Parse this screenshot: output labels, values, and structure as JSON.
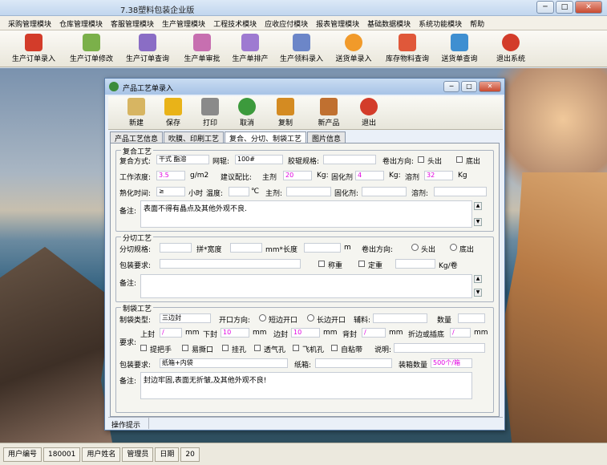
{
  "app": {
    "title": "7.38塑料包装企业版"
  },
  "window_buttons": {
    "min": "─",
    "max": "□",
    "close": "✕"
  },
  "menu": [
    "采购管理模块",
    "仓库管理模块",
    "客服管理模块",
    "生产管理模块",
    "工程技术模块",
    "应收应付模块",
    "报表管理模块",
    "基础数据模块",
    "系统功能模块",
    "帮助"
  ],
  "toolbar": [
    {
      "label": "生产订单录入",
      "icon": "pdf-icon",
      "color": "#d33c2a"
    },
    {
      "label": "生产订单修改",
      "icon": "flower-icon",
      "color": "#7bb04a"
    },
    {
      "label": "生产订单查询",
      "icon": "pen-doc-icon",
      "color": "#8a6dc5"
    },
    {
      "label": "生产单审批",
      "icon": "approve-icon",
      "color": "#c76fb0"
    },
    {
      "label": "生产单排产",
      "icon": "schedule-icon",
      "color": "#9e7ad1"
    },
    {
      "label": "生产领料录入",
      "icon": "material-icon",
      "color": "#6c86c8"
    },
    {
      "label": "送货单录入",
      "icon": "delivery-icon",
      "color": "#f19a2a"
    },
    {
      "label": "库存物料查询",
      "icon": "stock-icon",
      "color": "#e0583a"
    },
    {
      "label": "送货单查询",
      "icon": "feather-icon",
      "color": "#3f8fd1"
    },
    {
      "label": "退出系统",
      "icon": "power-icon",
      "color": "#d33c2a"
    }
  ],
  "status": [
    "用户编号",
    "180001",
    "用户姓名",
    "管理员",
    "日期",
    "20"
  ],
  "dialog": {
    "title": "产品工艺单录入",
    "toolbar": [
      {
        "label": "新建",
        "icon": "new-doc-icon",
        "color": "#d7b562"
      },
      {
        "label": "保存",
        "icon": "save-icon",
        "color": "#e9b318"
      },
      {
        "label": "打印",
        "icon": "print-icon",
        "color": "#8a8a8a"
      },
      {
        "label": "取消",
        "icon": "undo-icon",
        "color": "#3c9a3c"
      },
      {
        "label": "复制",
        "icon": "copy-icon",
        "color": "#d48b22"
      },
      {
        "label": "新产品",
        "icon": "new-product-icon",
        "color": "#c07030"
      },
      {
        "label": "退出",
        "icon": "power-icon",
        "color": "#d33c2a"
      }
    ],
    "tabs": [
      "产品工艺信息",
      "吹膜、印刷工艺",
      "复合、分切、制袋工艺",
      "图片信息"
    ],
    "composite": {
      "title": "复合工艺",
      "method_label": "复合方式:",
      "method_value": "干式",
      "method_value2": "酯溶",
      "mesh_label": "网辊:",
      "mesh_value": "100#",
      "film_spec_label": "胶辊规格:",
      "roll_dir_label": "卷出方向:",
      "head_out": "头出",
      "tail_out": "底出",
      "work_conc_label": "工作浓度:",
      "work_conc_value": "3.5",
      "work_conc_unit": "g/m2",
      "ratio_label": "建议配比:",
      "main_agent": "主剂",
      "main_value": "20",
      "kg1": "Kg:",
      "curing_agent": "固化剂",
      "curing_value": "4",
      "kg2": "Kg:",
      "solvent": "溶剂",
      "solvent_value": "32",
      "kg3": "Kg",
      "aging_label": "熟化时间:",
      "aging_value": "≥",
      "hours": "小时",
      "temp_label": "温度:",
      "temp_unit": "℃",
      "main2": "主剂:",
      "curing2": "固化剂:",
      "solvent2": "溶剂:",
      "note_label": "备注:",
      "note_value": "表面不得有晶点及其他外观不良."
    },
    "slitting": {
      "title": "分切工艺",
      "spec_label": "分切规格:",
      "split_width": "拼*宽度",
      "mm_len": "mm*长度",
      "m": "m",
      "roll_dir_label": "卷出方向:",
      "head_out": "头出",
      "tail_out": "底出",
      "pack_label": "包装要求:",
      "weigh": "称重",
      "fixed_weight": "定重",
      "kg_roll": "Kg/卷",
      "note_label": "备注:"
    },
    "bag": {
      "title": "制袋工艺",
      "type_label": "制袋类型:",
      "type_value": "三边封",
      "open_dir_label": "开口方向:",
      "short_open": "短边开口",
      "long_open": "长边开口",
      "aux_label": "辅料:",
      "qty_label": "数量",
      "req_label": "要求:",
      "top_label": "上封",
      "top_value": "/",
      "mm1": "mm",
      "bottom_label": "下封",
      "bottom_value": "10",
      "mm2": "mm",
      "side_label": "边封",
      "side_value": "10",
      "mm3": "mm",
      "back_label": "背封",
      "back_value": "/",
      "mm4": "mm",
      "fold_label": "折边或插底",
      "fold_value": "/",
      "mm5": "mm",
      "opts": [
        "提把手",
        "易撕口",
        "挂孔",
        "透气孔",
        "飞机孔",
        "自粘带"
      ],
      "desc_label": "说明:",
      "pack_label": "包装要求:",
      "pack_value": "纸箱+内袋",
      "carton_label": "纸箱:",
      "box_qty_label": "装箱数量",
      "box_qty_value": "500个/箱",
      "note_label": "备注:",
      "note_value": "封边牢固,表面无折皱,及其他外观不良!"
    },
    "hint": "操作提示"
  }
}
